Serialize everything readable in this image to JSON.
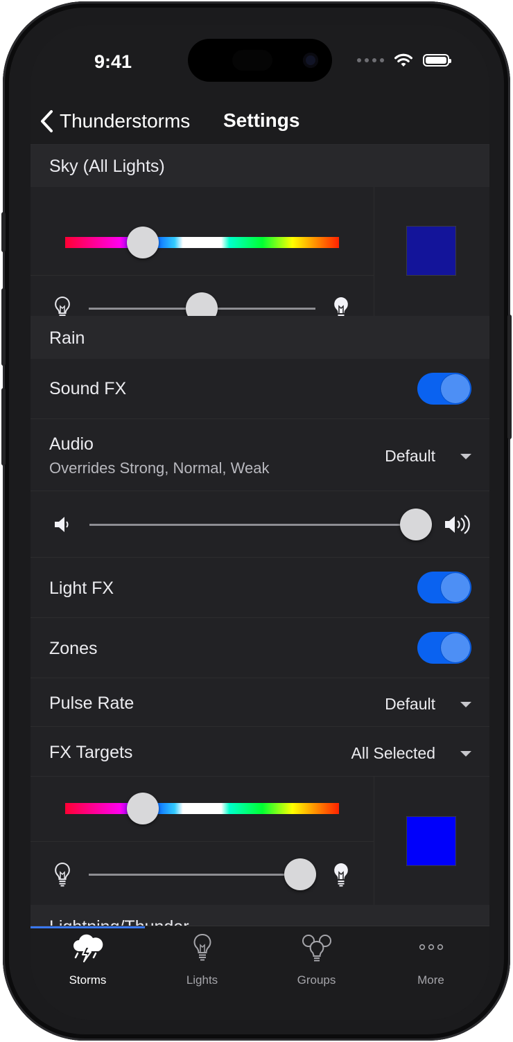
{
  "status": {
    "time": "9:41"
  },
  "nav": {
    "back_label": "Thunderstorms",
    "title": "Settings"
  },
  "sections": {
    "sky": "Sky (All Lights)",
    "rain": "Rain",
    "lightning_partial": "Lightning/Thunder"
  },
  "sky_controls": {
    "hue_position": 0.29,
    "brightness_position": 0.5,
    "swatch_color": "#13149a"
  },
  "rain": {
    "sound_fx": {
      "label": "Sound FX",
      "on": true
    },
    "audio": {
      "label": "Audio",
      "sublabel": "Overrides Strong, Normal, Weak",
      "value": "Default"
    },
    "volume_position": 1.0,
    "light_fx": {
      "label": "Light FX",
      "on": true
    },
    "zones": {
      "label": "Zones",
      "on": true
    },
    "pulse_rate": {
      "label": "Pulse Rate",
      "value": "Default"
    },
    "fx_targets": {
      "label": "FX Targets",
      "value": "All Selected"
    },
    "target_controls": {
      "hue_position": 0.29,
      "brightness_position": 0.94,
      "swatch_color": "#0000fb"
    }
  },
  "tabs": [
    {
      "label": "Storms",
      "icon": "storm-cloud-icon",
      "active": true
    },
    {
      "label": "Lights",
      "icon": "bulb-icon",
      "active": false
    },
    {
      "label": "Groups",
      "icon": "bulb-group-icon",
      "active": false
    },
    {
      "label": "More",
      "icon": "more-dots-icon",
      "active": false
    }
  ],
  "colors": {
    "accent": "#0a62f0",
    "toggle_knob": "#4d8ff5",
    "background": "#1c1c1e"
  }
}
